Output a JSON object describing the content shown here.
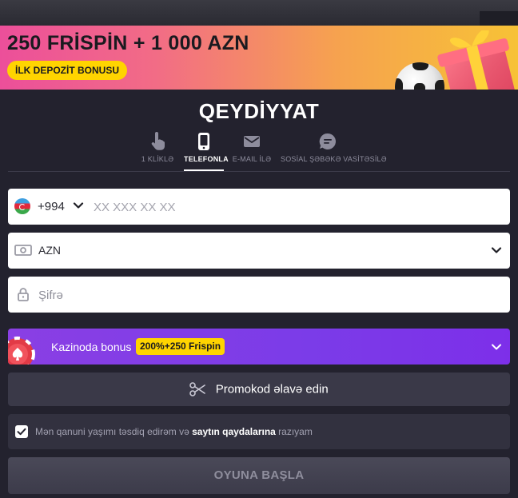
{
  "banner": {
    "headline": "250 FRİSPİN + 1 000 AZN",
    "badge": "İLK DEPOZİT BONUSU"
  },
  "registration": {
    "title": "QEYDİYYAT",
    "tabs": [
      {
        "label": "1 KLİKLƏ",
        "icon": "tap-icon",
        "active": false
      },
      {
        "label": "TELEFONLA",
        "icon": "phone-icon",
        "active": true
      },
      {
        "label": "E-MAIL İLƏ",
        "icon": "mail-icon",
        "active": false
      },
      {
        "label": "SOSİAL ŞƏBƏKƏ VASİTƏSİLƏ",
        "icon": "chat-icon",
        "active": false
      }
    ]
  },
  "form": {
    "phone": {
      "country_code": "+994",
      "placeholder": "XX XXX XX XX",
      "value": ""
    },
    "currency": {
      "value": "AZN"
    },
    "password": {
      "placeholder": "Şifrə",
      "value": ""
    },
    "bonus": {
      "label": "Kazinoda bonus",
      "badge": "200%+250 Frispin"
    },
    "promo": {
      "label": "Promokod əlavə edin"
    },
    "consent": {
      "checked": true,
      "text_before": "Mən qanuni yaşımı təsdiq edirəm və",
      "link": "saytın qaydalarına",
      "text_after": "razıyam"
    },
    "submit": {
      "label": "OYUNA BAŞLA"
    }
  },
  "colors": {
    "background": "#23222e",
    "accent_yellow": "#ffd400",
    "bonus_purple": "#7b3ce8",
    "field_bg": "#ffffff"
  }
}
